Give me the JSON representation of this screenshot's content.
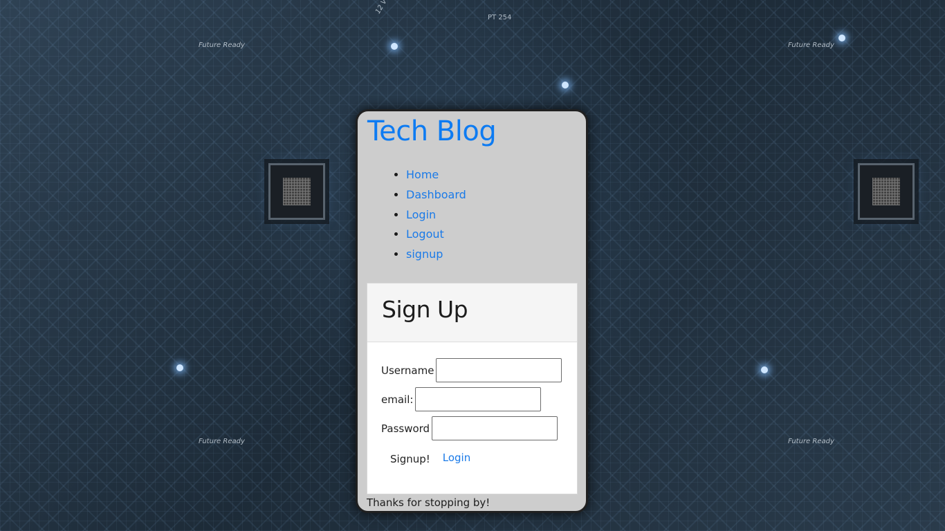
{
  "site": {
    "title": "Tech Blog"
  },
  "nav": {
    "items": [
      {
        "label": "Home"
      },
      {
        "label": "Dashboard"
      },
      {
        "label": "Login"
      },
      {
        "label": "Logout"
      },
      {
        "label": "signup"
      }
    ]
  },
  "signup_form": {
    "title": "Sign Up",
    "username_label": "Username",
    "username_value": "",
    "email_label": "email:",
    "email_value": "",
    "password_label": "Password",
    "password_value": "",
    "submit_label": "Signup!",
    "login_link_label": "Login"
  },
  "footer": {
    "text": "Thanks for stopping by!"
  },
  "background": {
    "labels": [
      "Future Ready",
      "Future Ready",
      "Future Ready",
      "Future Ready",
      "PT 254",
      "12 V"
    ]
  },
  "colors": {
    "title": "#0d7bf2",
    "link": "#1a7ae8",
    "card_bg": "#cdcdcd",
    "page_bg": "#1b2836"
  }
}
